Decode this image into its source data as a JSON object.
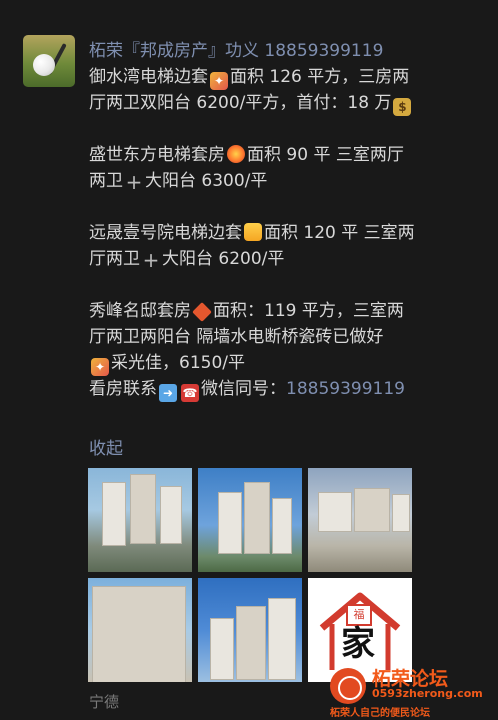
{
  "post": {
    "nickname": "柘荣『邦成房产』功义 18859399119",
    "listings": [
      {
        "line1_a": "御水湾电梯边套",
        "line1_b": "面积 126 平方，三房两",
        "line2_a": "厅两卫双阳台 6200/平方，首付：18 万",
        "emoji1": "party-popper",
        "emoji2": "money-bag"
      },
      {
        "line1_a": "盛世东方电梯套房",
        "line1_b": "面积 90 平 三室两厅",
        "line2_a": "两卫",
        "line2_b": "大阳台 6300/平",
        "emoji1": "firework",
        "emoji2": "plus"
      },
      {
        "line1_a": "远晟壹号院电梯边套",
        "line1_b": "面积 120 平 三室两",
        "line2_a": "厅两卫",
        "line2_b": "大阳台 6200/平",
        "emoji1": "gift",
        "emoji2": "plus"
      },
      {
        "line1_a": "秀峰名邸套房",
        "line1_b": "面积：119 平方，三室两",
        "line2_a": "厅两卫两阳台 隔墙水电断桥瓷砖已做好",
        "line3_a": "采光佳，6150/平",
        "line4_a": "看房联系",
        "line4_b": "微信同号：",
        "phone": "18859399119",
        "emoji1": "red-diamond-sign",
        "emoji2": "party-popper",
        "emoji3": "right-arrow",
        "emoji4": "telephone"
      }
    ],
    "collapse_label": "收起",
    "location": "宁德"
  },
  "photos": [
    {
      "name": "photo-1",
      "subject": "residential towers aerial view"
    },
    {
      "name": "photo-2",
      "subject": "residential towers blue sky"
    },
    {
      "name": "photo-3",
      "subject": "estate entrance gate"
    },
    {
      "name": "photo-4",
      "subject": "apartment building close-up"
    },
    {
      "name": "photo-5",
      "subject": "high-rise towers"
    },
    {
      "name": "photo-6",
      "subject": "home logo",
      "logo_char": "家",
      "stamp_char": "福"
    }
  ],
  "watermark": {
    "title": "柘荣论坛",
    "domain": "0593zherong.com",
    "slogan": "柘荣人自己的便民论坛"
  },
  "colors": {
    "background": "#191919",
    "link": "#7f8fb0",
    "text": "#d8d8d8",
    "watermark": "#f25a1a"
  }
}
